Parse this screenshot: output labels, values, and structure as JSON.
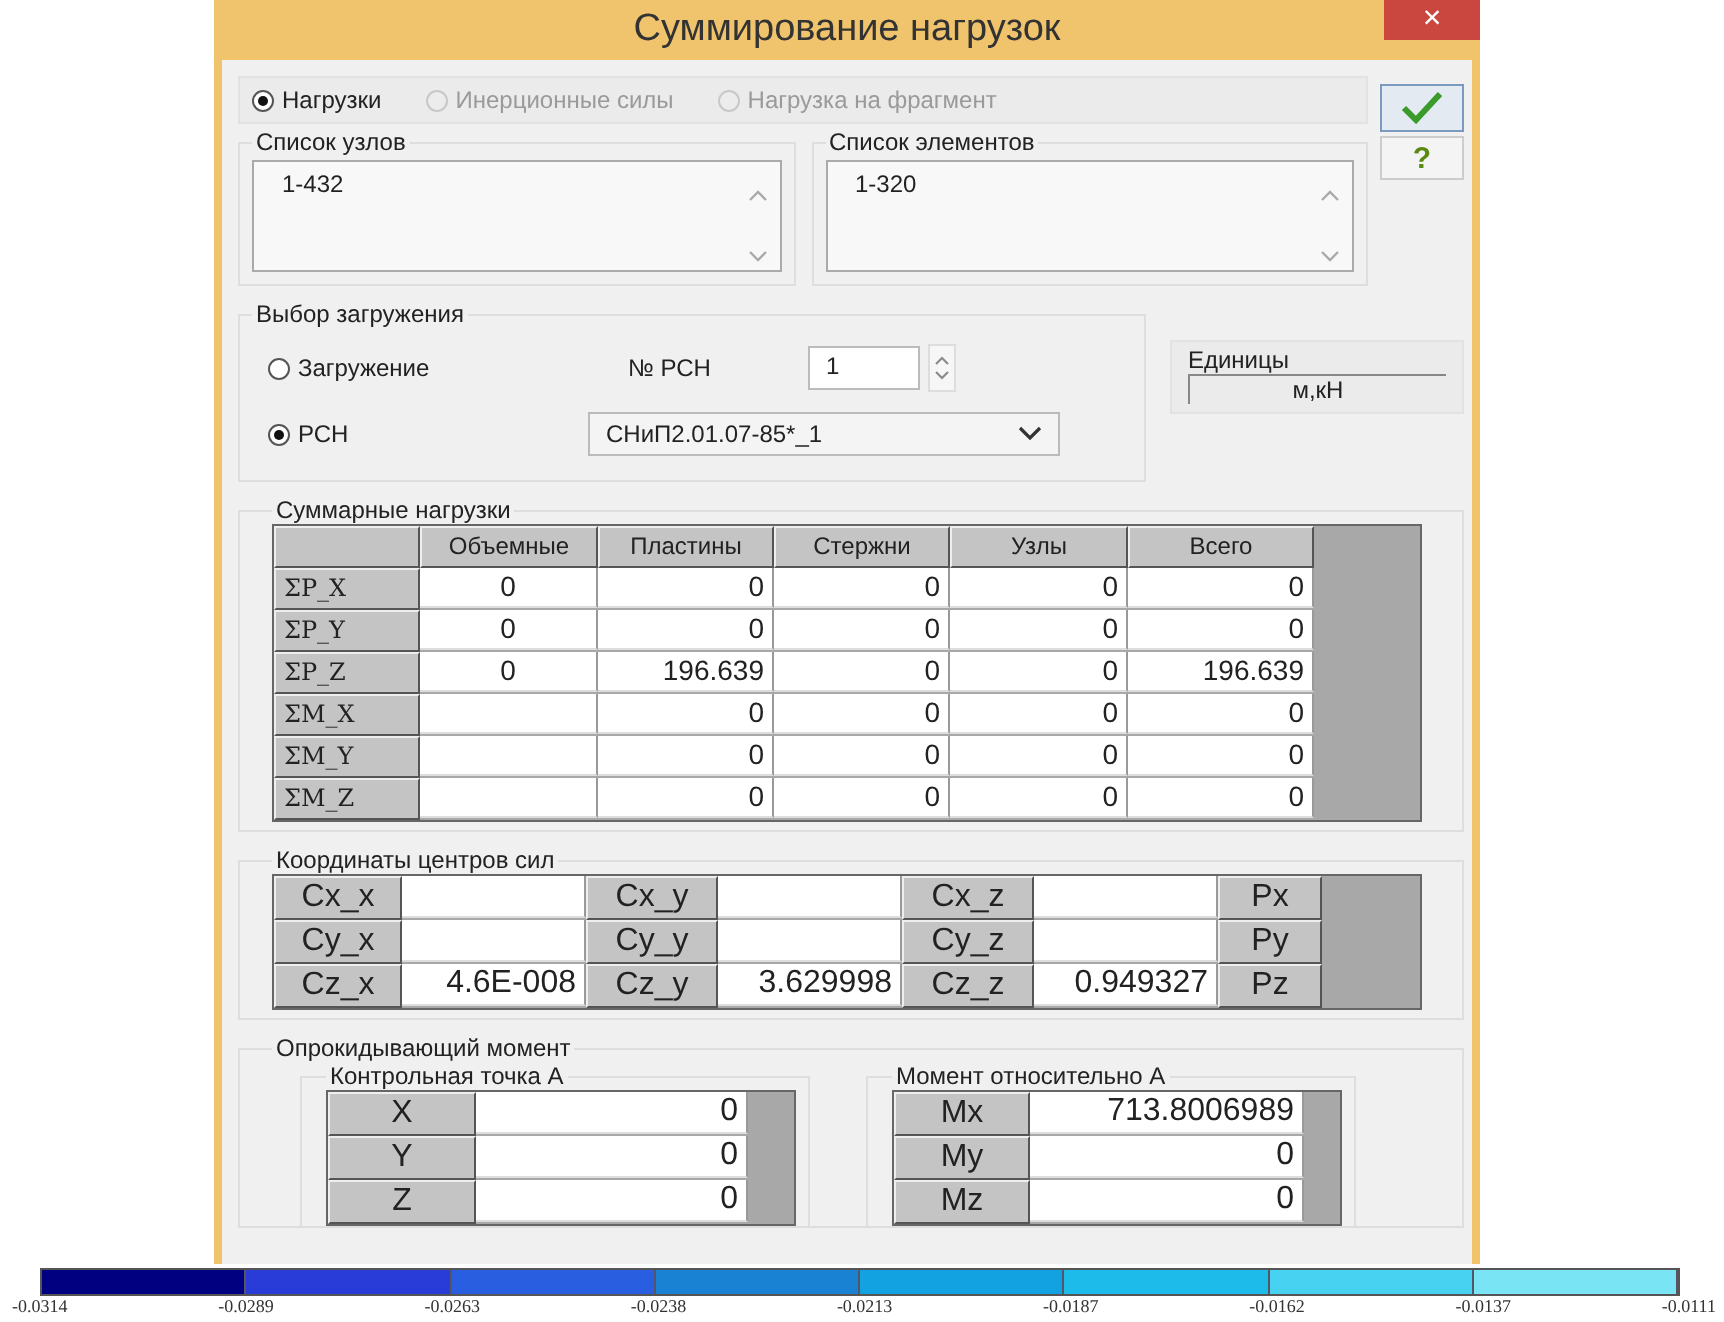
{
  "window": {
    "title": "Суммирование нагрузок",
    "close": "×"
  },
  "load_type_options": [
    {
      "label": "Нагрузки",
      "selected": true,
      "disabled": false
    },
    {
      "label": "Инерционные силы",
      "selected": false,
      "disabled": true
    },
    {
      "label": "Нагрузка на фрагмент",
      "selected": false,
      "disabled": true
    }
  ],
  "help_button": "?",
  "node_list": {
    "title": "Список узлов",
    "value": "1-432"
  },
  "element_list": {
    "title": "Список элементов",
    "value": "1-320"
  },
  "load_case": {
    "title": "Выбор загружения",
    "options": [
      {
        "label": "Загружение",
        "selected": false
      },
      {
        "label": "РСН",
        "selected": true
      }
    ],
    "number_label": "№ РСН",
    "number": "1",
    "combination": "СНиП2.01.07-85*_1"
  },
  "units": {
    "title": "Единицы",
    "value": "м,кН"
  },
  "total_loads": {
    "title": "Суммарные нагрузки",
    "columns": [
      "Объемные",
      "Пластины",
      "Стержни",
      "Узлы",
      "Всего"
    ],
    "rows": [
      {
        "header": "ΣP_X",
        "cells": [
          "0",
          "0",
          "0",
          "0",
          "0"
        ]
      },
      {
        "header": "ΣP_Y",
        "cells": [
          "0",
          "0",
          "0",
          "0",
          "0"
        ]
      },
      {
        "header": "ΣP_Z",
        "cells": [
          "0",
          "196.639",
          "0",
          "0",
          "196.639"
        ]
      },
      {
        "header": "ΣM_X",
        "cells": [
          null,
          "0",
          "0",
          "0",
          "0"
        ]
      },
      {
        "header": "ΣM_Y",
        "cells": [
          null,
          "0",
          "0",
          "0",
          "0"
        ]
      },
      {
        "header": "ΣM_Z",
        "cells": [
          null,
          "0",
          "0",
          "0",
          "0"
        ]
      }
    ]
  },
  "force_centers": {
    "title": "Координаты центров сил",
    "rows": [
      {
        "pairs": [
          {
            "label": "Cx_x"
          },
          {
            "label": "Cx_y"
          },
          {
            "label": "Cx_z"
          }
        ],
        "p_label": "Px"
      },
      {
        "pairs": [
          {
            "label": "Cy_x"
          },
          {
            "label": "Cy_y"
          },
          {
            "label": "Cy_z"
          }
        ],
        "p_label": "Py"
      },
      {
        "pairs": [
          {
            "label": "Cz_x",
            "value": "4.6E-008"
          },
          {
            "label": "Cz_y",
            "value": "3.629998"
          },
          {
            "label": "Cz_z",
            "value": "0.949327"
          }
        ],
        "p_label": "Pz"
      }
    ]
  },
  "overturning_moment": {
    "title": "Опрокидывающий момент",
    "control_point": {
      "title": "Контрольная точка А",
      "rows": [
        {
          "label": "X",
          "value": "0"
        },
        {
          "label": "Y",
          "value": "0"
        },
        {
          "label": "Z",
          "value": "0"
        }
      ]
    },
    "moment": {
      "title": "Момент относительно А",
      "rows": [
        {
          "label": "Mx",
          "value": "713.8006989"
        },
        {
          "label": "My",
          "value": "0"
        },
        {
          "label": "Mz",
          "value": "0"
        }
      ]
    }
  },
  "color_scale": {
    "segments": [
      {
        "color": "#000080"
      },
      {
        "color": "#2a3cd8"
      },
      {
        "color": "#2a5ee0"
      },
      {
        "color": "#1a82d2"
      },
      {
        "color": "#12a2e2"
      },
      {
        "color": "#1cbbea"
      },
      {
        "color": "#48d2f2"
      },
      {
        "color": "#78e4f4"
      }
    ],
    "ticks": [
      "-0.0314",
      "-0.0289",
      "-0.0263",
      "-0.0238",
      "-0.0213",
      "-0.0187",
      "-0.0162",
      "-0.0137",
      "-0.0111"
    ]
  }
}
